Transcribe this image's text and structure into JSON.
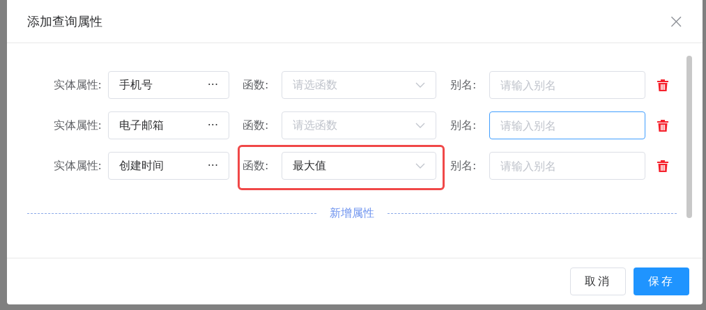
{
  "dialog": {
    "title": "添加查询属性",
    "close": "×"
  },
  "rows": [
    {
      "entity_label": "实体属性:",
      "entity": "手机号",
      "more": "···",
      "function_label": "函数:",
      "function_placeholder": "请选函数",
      "alias_label": "别名:",
      "alias_placeholder": "请输入别名",
      "alias_focused": false,
      "highlighted": false
    },
    {
      "entity_label": "实体属性:",
      "entity": "电子邮箱",
      "more": "···",
      "function_label": "函数:",
      "function_placeholder": "请选函数",
      "alias_label": "别名:",
      "alias_placeholder": "请输入别名",
      "alias_focused": true,
      "highlighted": false
    },
    {
      "entity_label": "实体属性:",
      "entity": "创建时间",
      "more": "···",
      "function_label": "函数:",
      "function_value": "最大值",
      "alias_label": "别名:",
      "alias_placeholder": "请输入别名",
      "alias_focused": false,
      "highlighted": true
    }
  ],
  "add_button": "新增属性",
  "footer": {
    "cancel": "取消",
    "save": "保存"
  }
}
